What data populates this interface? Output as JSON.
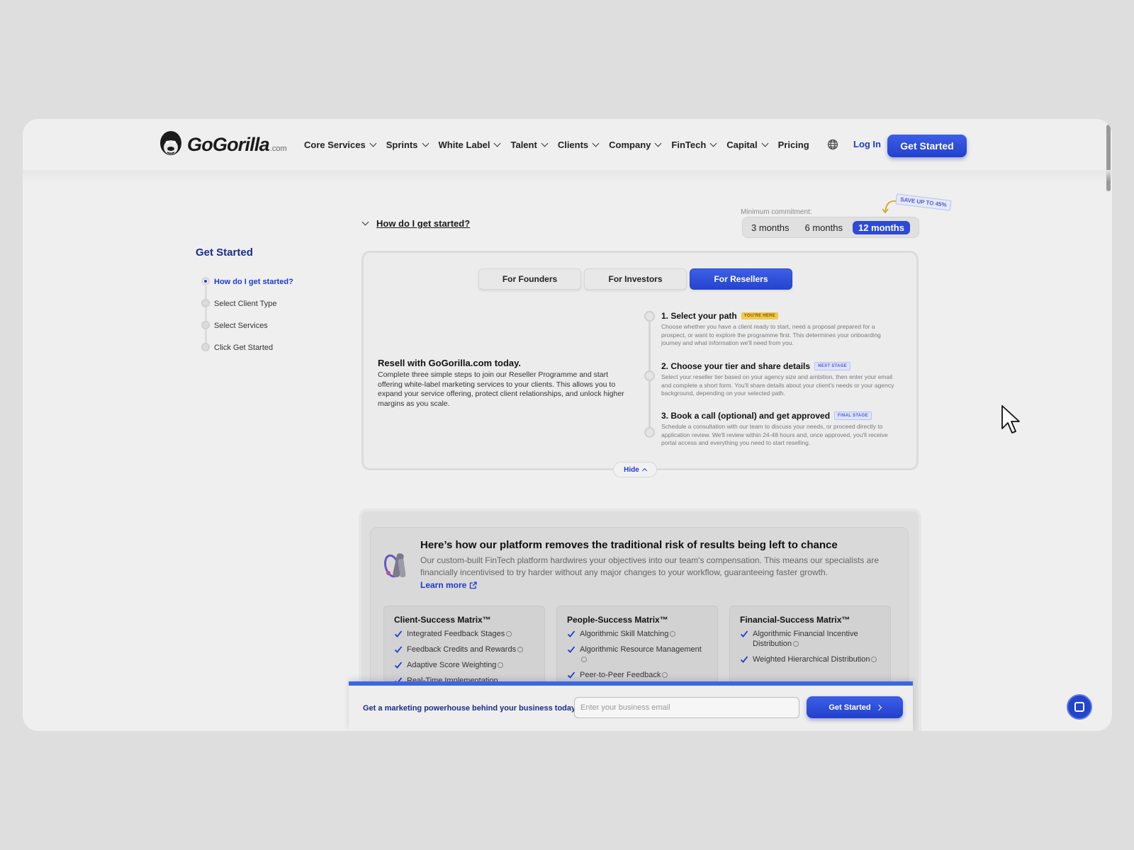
{
  "brand": {
    "name": "GoGorilla",
    "suffix": ".com"
  },
  "nav": {
    "items": [
      {
        "label": "Core Services",
        "dropdown": true
      },
      {
        "label": "Sprints",
        "dropdown": true
      },
      {
        "label": "White Label",
        "dropdown": true
      },
      {
        "label": "Talent",
        "dropdown": true
      },
      {
        "label": "Clients",
        "dropdown": true
      },
      {
        "label": "Company",
        "dropdown": true
      },
      {
        "label": "FinTech",
        "dropdown": true
      },
      {
        "label": "Capital",
        "dropdown": true
      },
      {
        "label": "Pricing",
        "dropdown": false
      }
    ],
    "login": "Log In",
    "cta": "Get Started",
    "globe_icon": "globe-icon"
  },
  "sidebar": {
    "title": "Get Started",
    "steps": [
      {
        "label": "How do I get started?",
        "active": true
      },
      {
        "label": "Select Client Type",
        "active": false
      },
      {
        "label": "Select Services",
        "active": false
      },
      {
        "label": "Click Get Started",
        "active": false
      }
    ]
  },
  "getting_started": {
    "toggle_label": "How do I get started?",
    "commitment_label": "Minimum commitment:",
    "save_badge": "SAVE UP TO 45%",
    "commitment_options": [
      "3 months",
      "6 months",
      "12 months"
    ],
    "commitment_selected": "12 months",
    "tabs": [
      "For Founders",
      "For Investors",
      "For Resellers"
    ],
    "tab_selected": "For Resellers",
    "heading": "Resell with GoGorilla.com today.",
    "body": "Complete three simple steps to join our Reseller Programme and start offering white-label marketing services to your clients. This allows you to expand your service offering, protect client relationships, and unlock higher margins as you scale.",
    "steps": [
      {
        "title": "1. Select your path",
        "badge": "YOU'RE HERE",
        "text": "Choose whether you have a client ready to start, need a proposal prepared for a prospect, or want to explore the programme first. This determines your onboarding journey and what information we'll need from you."
      },
      {
        "title": "2. Choose your tier and share details",
        "badge": "NEXT STAGE",
        "text": "Select your reseller tier based on your agency size and ambition, then enter your email and complete a short form. You'll share details about your client's needs or your agency background, depending on your selected path."
      },
      {
        "title": "3. Book a call (optional) and get approved",
        "badge": "FINAL STAGE",
        "text": "Schedule a consultation with our team to discuss your needs, or proceed directly to application review. We'll review within 24-48 hours and, once approved, you'll receive portal access and everything you need to start reselling."
      }
    ],
    "hide_label": "Hide"
  },
  "platform": {
    "heading": "Here’s how our platform removes the traditional risk of results being left to chance",
    "body": "Our custom-built FinTech platform hardwires your objectives into our team's compensation. This means our specialists are financially incentivised to try harder without any major changes to your workflow, guaranteeing faster growth.",
    "learn_more": "Learn more",
    "matrices": [
      {
        "title": "Client-Success Matrix™",
        "items": [
          "Integrated Feedback Stages",
          "Feedback Credits and Rewards",
          "Adaptive Score Weighting",
          "Real-Time Implementation"
        ]
      },
      {
        "title": "People-Success Matrix™",
        "items": [
          "Algorithmic Skill Matching",
          "Algorithmic Resource Management",
          "Peer-to-Peer Feedback"
        ]
      },
      {
        "title": "Financial-Success Matrix™",
        "items": [
          "Algorithmic Financial Incentive Distribution",
          "Weighted Hierarchical Distribution"
        ]
      }
    ]
  },
  "sticky_bar": {
    "label": "Get a marketing powerhouse behind your business today:",
    "input_placeholder": "Enter your business email",
    "button": "Get Started"
  },
  "colors": {
    "accent": "#2d4ad6",
    "link": "#1d3bc9",
    "sidebar_title": "#1a2c8c",
    "badge_here": "#f2c94c",
    "page_bg": "#dedede",
    "frame_bg": "#efefef"
  }
}
